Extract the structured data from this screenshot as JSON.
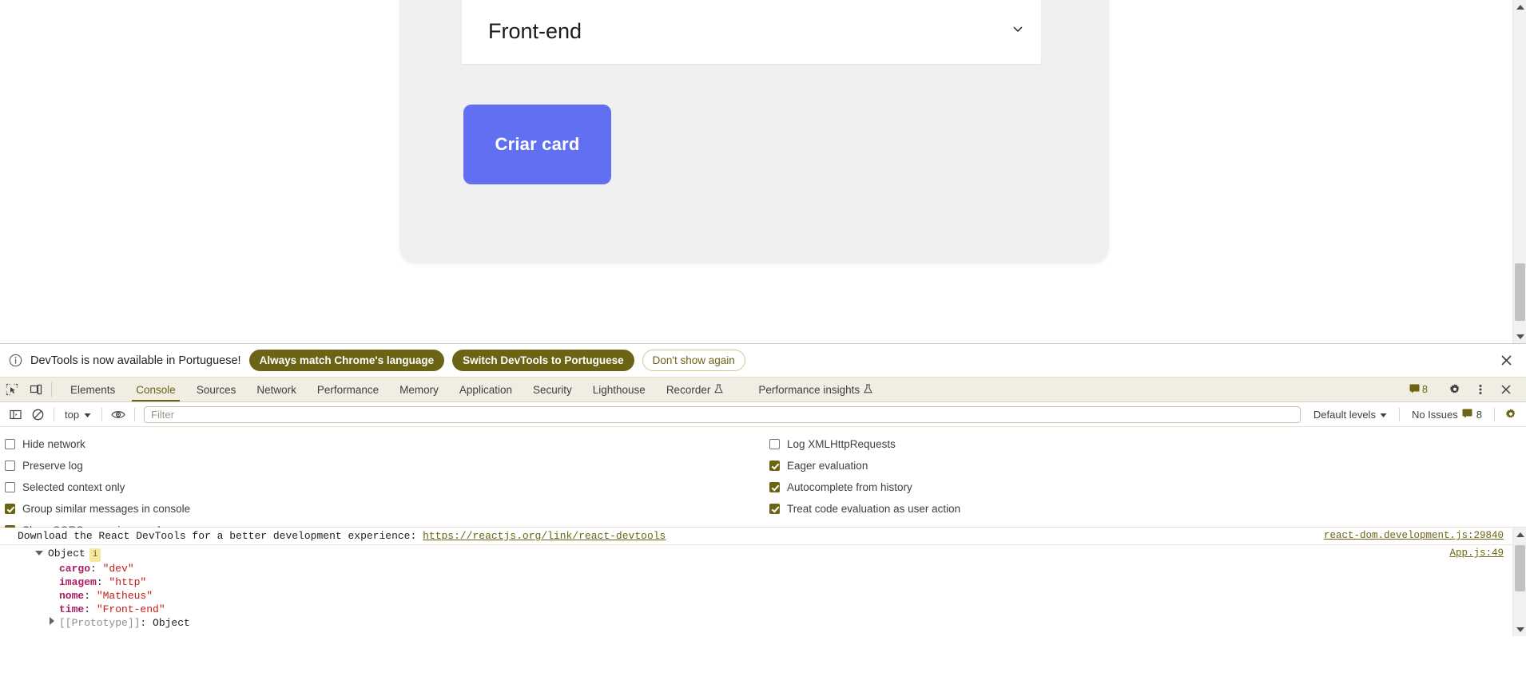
{
  "page": {
    "cargo_select": {
      "value": "Front-end",
      "chevron_icon": "chevron-down-icon"
    },
    "create_button_label": "Criar card",
    "accent_color": "#6170f0",
    "card_background": "#f0f0f0"
  },
  "devtools": {
    "notification": {
      "info_icon": "info-circle-icon",
      "message": "DevTools is now available in Portuguese!",
      "buttons": [
        {
          "label": "Always match Chrome's language",
          "style": "primary"
        },
        {
          "label": "Switch DevTools to Portuguese",
          "style": "primary"
        },
        {
          "label": "Don't show again",
          "style": "ghost"
        }
      ],
      "close_icon": "close-icon"
    },
    "tabbar": {
      "inspect_icon": "inspect-element-icon",
      "device_icon": "device-toolbar-icon",
      "tabs": [
        {
          "label": "Elements",
          "active": false,
          "icon": null
        },
        {
          "label": "Console",
          "active": true,
          "icon": null
        },
        {
          "label": "Sources",
          "active": false,
          "icon": null
        },
        {
          "label": "Network",
          "active": false,
          "icon": null
        },
        {
          "label": "Performance",
          "active": false,
          "icon": null
        },
        {
          "label": "Memory",
          "active": false,
          "icon": null
        },
        {
          "label": "Application",
          "active": false,
          "icon": null
        },
        {
          "label": "Security",
          "active": false,
          "icon": null
        },
        {
          "label": "Lighthouse",
          "active": false,
          "icon": null
        },
        {
          "label": "Recorder",
          "active": false,
          "icon": "flask-icon"
        },
        {
          "label": "Performance insights",
          "active": false,
          "icon": "flask-icon"
        }
      ],
      "issues_count": "8",
      "issues_icon": "message-badge-icon",
      "settings_icon": "gear-icon",
      "more_icon": "kebab-menu-icon",
      "close_icon": "close-icon",
      "accent_color": "#6b6414"
    },
    "console_toolbar": {
      "sidebar_icon": "console-sidebar-icon",
      "clear_icon": "clear-console-icon",
      "context": "top",
      "context_chevron_icon": "chevron-down-icon",
      "eye_icon": "live-expression-eye-icon",
      "filter_placeholder": "Filter",
      "filter_value": "",
      "levels_label": "Default levels",
      "levels_chevron_icon": "chevron-down-icon",
      "issues_label": "No Issues",
      "issues_icon": "message-badge-icon",
      "issues_count": "8",
      "settings_icon": "gear-icon"
    },
    "console_settings": {
      "left_column": [
        {
          "label": "Hide network",
          "checked": false
        },
        {
          "label": "Preserve log",
          "checked": false
        },
        {
          "label": "Selected context only",
          "checked": false
        },
        {
          "label": "Group similar messages in console",
          "checked": true
        },
        {
          "label": "Show CORS errors in console",
          "checked": true
        }
      ],
      "right_column": [
        {
          "label": "Log XMLHttpRequests",
          "checked": false
        },
        {
          "label": "Eager evaluation",
          "checked": true
        },
        {
          "label": "Autocomplete from history",
          "checked": true
        },
        {
          "label": "Treat code evaluation as user action",
          "checked": true
        }
      ]
    },
    "console_output": {
      "react_message": {
        "text": "Download the React DevTools for a better development experience: ",
        "link": "https://reactjs.org/link/react-devtools",
        "source": "react-dom.development.js:29840"
      },
      "object_log": {
        "label": "Object",
        "badge": "i",
        "source": "App.js:49",
        "properties": [
          {
            "key": "cargo",
            "value": "\"dev\""
          },
          {
            "key": "imagem",
            "value": "\"http\""
          },
          {
            "key": "nome",
            "value": "\"Matheus\""
          },
          {
            "key": "time",
            "value": "\"Front-end\""
          }
        ],
        "prototype_key": "[[Prototype]]",
        "prototype_value": "Object"
      }
    }
  }
}
